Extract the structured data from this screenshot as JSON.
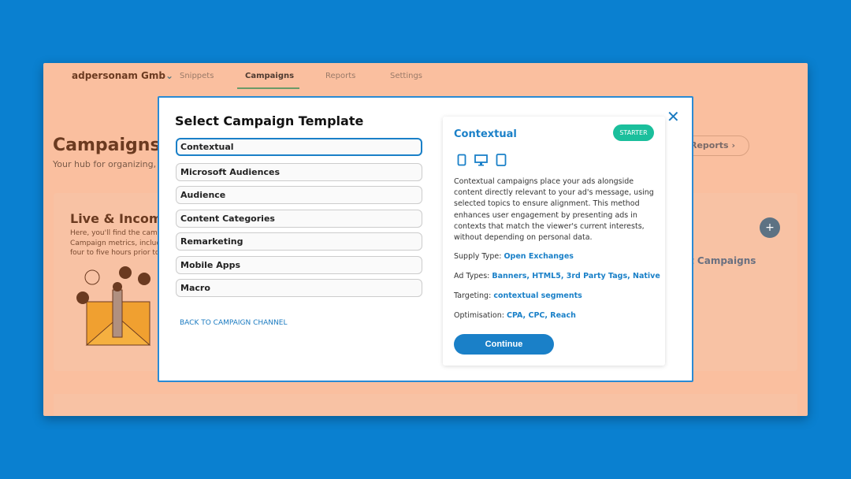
{
  "nav": {
    "org": "adpersonam Gmb",
    "tabs": [
      "Snippets",
      "Campaigns",
      "Reports",
      "Settings"
    ],
    "active": "Campaigns"
  },
  "page": {
    "title": "Campaigns",
    "subtitle": "Your hub for organizing, m",
    "reports_button": "Reports",
    "live_title": "Live & Incomi",
    "live_text": "Here, you'll find the camp Campaign metrics, incluc four to five hours prior to",
    "campaigns_hint": "t Campaigns"
  },
  "modal": {
    "title": "Select Campaign Template",
    "options": [
      "Contextual",
      "Microsoft Audiences",
      "Audience",
      "Content Categories",
      "Remarketing",
      "Mobile Apps",
      "Macro"
    ],
    "selected": "Contextual",
    "back_link": "BACK TO CAMPAIGN CHANNEL",
    "detail": {
      "title": "Contextual",
      "badge": "STARTER",
      "devices": [
        "mobile-icon",
        "desktop-icon",
        "tablet-icon"
      ],
      "description": "Contextual campaigns place your ads alongside content directly relevant to your ad's message, using selected topics to ensure alignment. This method enhances user engagement by presenting ads in contexts that match the viewer's current interests, without depending on personal data.",
      "supply_label": "Supply Type:",
      "supply": "Open Exchanges",
      "adtypes_label": "Ad Types:",
      "adtypes": "Banners, HTML5, 3rd Party Tags, Native",
      "targeting_label": "Targeting:",
      "targeting": "contextual segments",
      "optimisation_label": "Optimisation:",
      "optimisation": "CPA, CPC, Reach",
      "continue": "Continue"
    }
  },
  "colors": {
    "background": "#0a80d0",
    "accent": "#1a80c8",
    "badge": "#1bbf9c",
    "overlay": "#fabf9f"
  }
}
